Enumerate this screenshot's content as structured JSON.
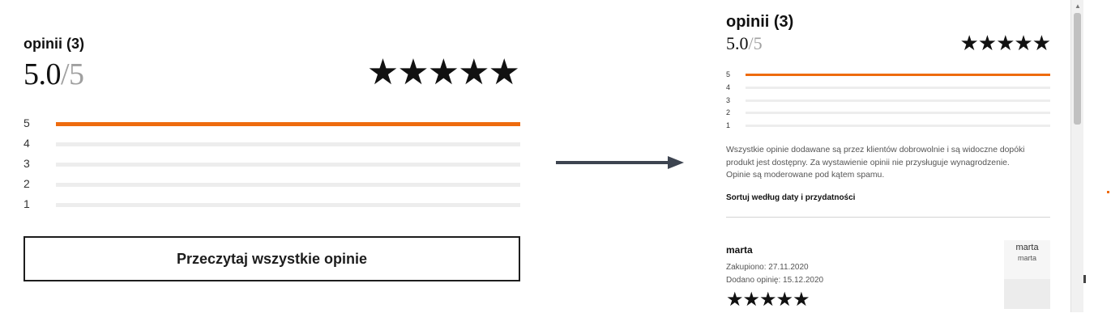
{
  "left": {
    "title": "opinii (3)",
    "score": "5.0",
    "score_max": "/5",
    "stars": "★★★★★",
    "distribution": [
      {
        "label": "5",
        "fraction": 1.0
      },
      {
        "label": "4",
        "fraction": 0.0
      },
      {
        "label": "3",
        "fraction": 0.0
      },
      {
        "label": "2",
        "fraction": 0.0
      },
      {
        "label": "1",
        "fraction": 0.0
      }
    ],
    "read_all_button": "Przeczytaj wszystkie opinie"
  },
  "right": {
    "title": "opinii (3)",
    "score": "5.0",
    "score_max": "/5",
    "stars": "★★★★★",
    "distribution": [
      {
        "label": "5",
        "fraction": 1.0
      },
      {
        "label": "4",
        "fraction": 0.0
      },
      {
        "label": "3",
        "fraction": 0.0
      },
      {
        "label": "2",
        "fraction": 0.0
      },
      {
        "label": "1",
        "fraction": 0.0
      }
    ],
    "description_lines": [
      "Wszystkie opinie dodawane są przez klientów dobrowolnie i są widoczne dopóki",
      "produkt jest dostępny. Za wystawienie opinii nie przysługuje wynagrodzenie.",
      "Opinie są moderowane pod kątem spamu."
    ],
    "sort_label": "Sortuj według daty i przydatności",
    "review": {
      "author": "marta",
      "purchased": "Zakupiono: 27.11.2020",
      "added": "Dodano opinię: 15.12.2020",
      "stars": "★★★★★",
      "card_name": "marta",
      "card_subname": "marta"
    }
  },
  "colors": {
    "accent": "#ee6b0e",
    "text": "#111111",
    "muted": "#a0a0a0",
    "track": "#ededed",
    "arrow": "#3d4450"
  },
  "icons": {
    "arrow": "arrow-right-icon",
    "scroll_up": "scroll-up-icon"
  }
}
